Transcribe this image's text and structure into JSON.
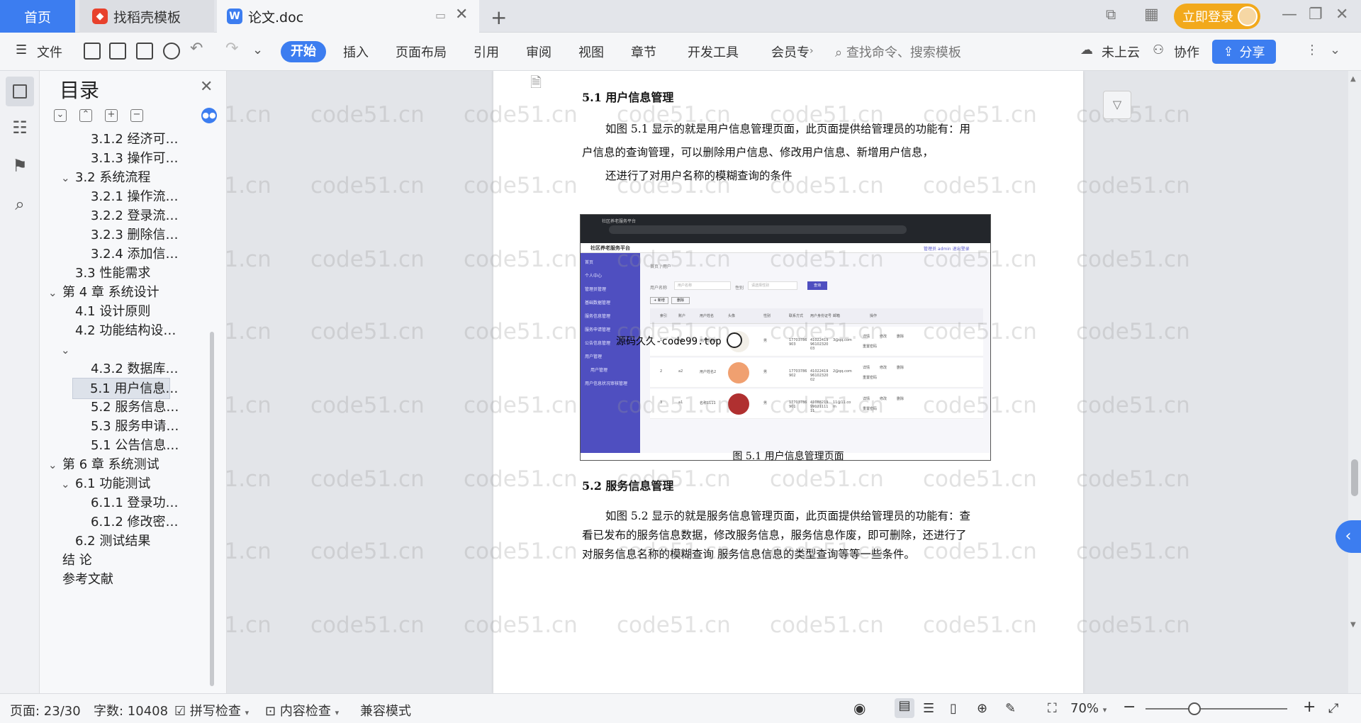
{
  "tabs": {
    "home": "首页",
    "template": "找稻壳模板",
    "doc": "论文.doc",
    "login": "立即登录"
  },
  "ribbon": {
    "file": "文件",
    "start": "开始",
    "insert": "插入",
    "layout": "页面布局",
    "reference": "引用",
    "review": "审阅",
    "view": "视图",
    "chapter": "章节",
    "devtools": "开发工具",
    "member": "会员专",
    "search_placeholder": "查找命令、搜索模板",
    "cloud": "未上云",
    "collab": "协作",
    "share": "分享"
  },
  "toc": {
    "title": "目录",
    "items": [
      {
        "label": "3.1.2 经济可…",
        "level": 3
      },
      {
        "label": "3.1.3 操作可…",
        "level": 3
      },
      {
        "label": "3.2 系统流程",
        "level": 2,
        "expanded": true
      },
      {
        "label": "3.2.1 操作流…",
        "level": 3
      },
      {
        "label": "3.2.2 登录流…",
        "level": 3
      },
      {
        "label": "3.2.3 删除信…",
        "level": 3
      },
      {
        "label": "3.2.4 添加信…",
        "level": 3
      },
      {
        "label": "3.3 性能需求",
        "level": 2
      },
      {
        "label": "第 4 章  系统设计",
        "level": 1,
        "expanded": true
      },
      {
        "label": "4.1 设计原则",
        "level": 2
      },
      {
        "label": "4.2 功能结构设…",
        "level": 2
      },
      {
        "label": "",
        "level": 2,
        "expanded": true
      },
      {
        "label": "4.3.2 数据库…",
        "level": 3
      },
      {
        "label": "5.1 用户信息…",
        "level": 3,
        "selected": true
      },
      {
        "label": "5.2 服务信息…",
        "level": 3
      },
      {
        "label": "5.3 服务申请…",
        "level": 3
      },
      {
        "label": "5.1 公告信息…",
        "level": 3
      },
      {
        "label": "第 6 章  系统测试",
        "level": 1,
        "expanded": true
      },
      {
        "label": "6.1 功能测试",
        "level": 2,
        "expanded": true
      },
      {
        "label": "6.1.1 登录功…",
        "level": 3
      },
      {
        "label": "6.1.2 修改密…",
        "level": 3
      },
      {
        "label": "6.2 测试结果",
        "level": 2
      },
      {
        "label": "结    论",
        "level": 1
      },
      {
        "label": "参考文献",
        "level": 1
      }
    ]
  },
  "document": {
    "heading1": "5.1 用户信息管理",
    "para1_line1": "如图 5.1 显示的就是用户信息管理页面，此页面提供给管理员的功能有：用",
    "para1_line2": "户信息的查询管理，可以删除用户信息、修改用户信息、新增用户信息，",
    "para1_line3": "还进行了对用户名称的模糊查询的条件",
    "caption": "图 5.1  用户信息管理页面",
    "heading2": "5.2  服务信息管理",
    "para2_line1": "如图 5.2 显示的就是服务信息管理页面，此页面提供给管理员的功能有：查",
    "para2_line2": "看已发布的服务信息数据，修改服务信息，服务信息作废，即可删除，还进行了",
    "para2_line3": "对服务信息名称的模糊查询  服务信息信息的类型查询等等一些条件。",
    "overlay_text": "源码久久-code99.top",
    "screenshot": {
      "app_title": "社区养老服务平台",
      "admin_text": "管理员 admin   退出登录",
      "breadcrumb": "首页 / 用户",
      "search_label": "用户名称",
      "search_placeholder": "用户名称",
      "gender_label": "性别",
      "gender_placeholder": "请选择性别",
      "search_button": "查询",
      "add_button": "+ 新增",
      "delete_button": "删除",
      "menu": [
        "首页",
        "个人中心",
        "管理员管理",
        "基础数据管理",
        "服务信息管理",
        "服务申请管理",
        "公告信息管理",
        "用户管理",
        "用户管理",
        "用户信息状况审核管理"
      ],
      "columns": [
        "索引",
        "账户",
        "用户姓名",
        "头像",
        "性别",
        "联系方式",
        "用户身份证号",
        "邮箱",
        "操作"
      ],
      "rows": [
        {
          "index": "1",
          "account": "a3",
          "name": "用户姓名3",
          "gender": "男",
          "phone": "17703786903",
          "idcard": "410224199610232003",
          "email": "3@qq.com"
        },
        {
          "index": "2",
          "account": "a2",
          "name": "用户姓名2",
          "gender": "男",
          "phone": "17703786902",
          "idcard": "410224199610232002",
          "email": "2@qq.com"
        },
        {
          "index": "3",
          "account": "a1",
          "name": "名称1111",
          "gender": "男",
          "phone": "17703786901",
          "idcard": "410882199912111111",
          "email": "11@11.com"
        }
      ],
      "row_actions": [
        "详情",
        "修改",
        "删除",
        "重置密码"
      ]
    }
  },
  "watermark": "code51.cn",
  "status": {
    "page": "页面: 23/30",
    "words": "字数: 10408",
    "spell": "拼写检查",
    "content_check": "内容检查",
    "compat": "兼容模式",
    "zoom": "70%"
  },
  "colors": {
    "accent": "#3c7df0",
    "login": "#f2a91c",
    "sidebar_purple": "#4f4fc0"
  }
}
